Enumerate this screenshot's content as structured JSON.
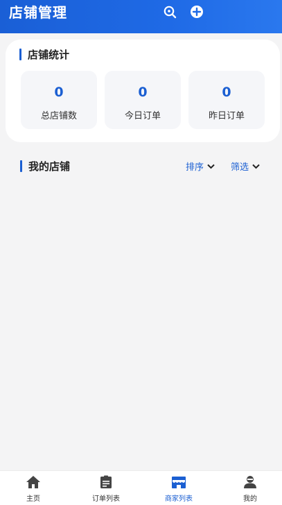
{
  "header": {
    "title": "店铺管理",
    "icons": [
      "search-icon",
      "add-icon"
    ]
  },
  "stats": {
    "title": "店铺统计",
    "items": [
      {
        "value": "0",
        "label": "总店铺数"
      },
      {
        "value": "0",
        "label": "今日订单"
      },
      {
        "value": "0",
        "label": "昨日订单"
      }
    ]
  },
  "shops": {
    "title": "我的店铺",
    "sort_label": "排序",
    "filter_label": "筛选"
  },
  "tabbar": {
    "items": [
      {
        "label": "主页",
        "icon": "home-icon"
      },
      {
        "label": "订单列表",
        "icon": "order-list-icon"
      },
      {
        "label": "商家列表",
        "icon": "store-icon",
        "active": true
      },
      {
        "label": "我的",
        "icon": "user-icon"
      }
    ]
  },
  "colors": {
    "accent": "#1b5fd2",
    "header_gradient_start": "#1a5fd6",
    "header_gradient_end": "#2a78ee"
  }
}
